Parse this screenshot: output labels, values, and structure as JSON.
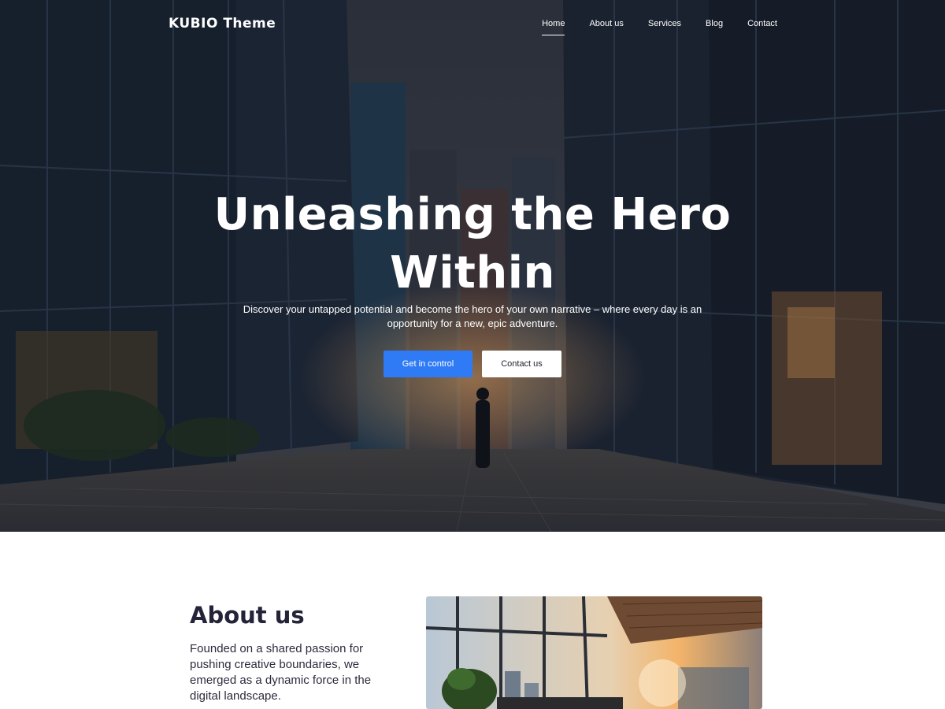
{
  "header": {
    "logo": "KUBIO Theme",
    "nav": [
      {
        "label": "Home",
        "active": true
      },
      {
        "label": "About us",
        "active": false
      },
      {
        "label": "Services",
        "active": false
      },
      {
        "label": "Blog",
        "active": false
      },
      {
        "label": "Contact",
        "active": false
      }
    ]
  },
  "hero": {
    "title": "Unleashing the Hero Within",
    "subtitle": "Discover your untapped potential and become the hero of your own narrative – where every day is an opportunity for a new, epic adventure.",
    "primary_button": "Get in control",
    "secondary_button": "Contact us"
  },
  "about": {
    "title": "About us",
    "text": "Founded on a shared passion for pushing creative boundaries, we emerged as a dynamic force in the digital landscape."
  },
  "colors": {
    "accent": "#2f7bf5",
    "heading": "#23233a",
    "white": "#ffffff"
  }
}
